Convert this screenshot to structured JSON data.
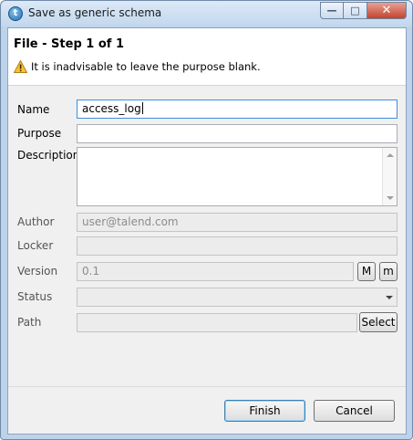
{
  "window": {
    "title": "Save as generic schema",
    "app_icon_glyph": "t",
    "minimize_glyph": "—",
    "maximize_glyph": "□",
    "close_glyph": "✕"
  },
  "header": {
    "title": "File - Step 1 of 1",
    "warning": "It is inadvisable to leave the purpose blank.",
    "warning_icon": "warning-icon"
  },
  "form": {
    "name": {
      "label": "Name",
      "value": "access_log"
    },
    "purpose": {
      "label": "Purpose",
      "value": ""
    },
    "description": {
      "label": "Description",
      "value": ""
    },
    "author": {
      "label": "Author",
      "value": "user@talend.com"
    },
    "locker": {
      "label": "Locker",
      "value": ""
    },
    "version": {
      "label": "Version",
      "value": "0.1",
      "major_button": "M",
      "minor_button": "m"
    },
    "status": {
      "label": "Status",
      "value": ""
    },
    "path": {
      "label": "Path",
      "value": "",
      "select_button": "Select"
    }
  },
  "footer": {
    "finish_label": "Finish",
    "cancel_label": "Cancel"
  },
  "colors": {
    "window_frame": "#bcd3ea",
    "dialog_bg": "#f0f0f0",
    "close_button": "#c2442d",
    "default_button_border": "#3c7fb1"
  }
}
